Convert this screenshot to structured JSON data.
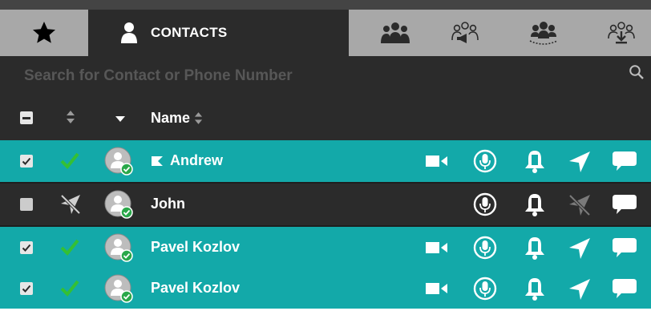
{
  "tabs": {
    "favorites_icon": "star-icon",
    "contacts_label": "CONTACTS",
    "group_icons": [
      "group-icon",
      "broadcast-group-icon",
      "dispatch-group-icon",
      "download-group-icon"
    ]
  },
  "search": {
    "placeholder": "Search for Contact or Phone Number"
  },
  "header": {
    "name_label": "Name"
  },
  "contacts": [
    {
      "name": "Andrew",
      "selected": true,
      "flag": true,
      "online": true,
      "actions": [
        "video-call-icon",
        "microphone-icon",
        "bell-icon",
        "location-icon",
        "chat-icon"
      ]
    },
    {
      "name": "John",
      "selected": false,
      "flag": false,
      "online": false,
      "actions": [
        "microphone-icon",
        "bell-icon",
        "location-off-icon",
        "chat-icon"
      ]
    },
    {
      "name": "Pavel Kozlov",
      "selected": true,
      "flag": false,
      "online": true,
      "actions": [
        "video-call-icon",
        "microphone-icon",
        "bell-icon",
        "location-icon",
        "chat-icon"
      ]
    },
    {
      "name": "Pavel Kozlov",
      "selected": true,
      "flag": false,
      "online": true,
      "actions": [
        "video-call-icon",
        "microphone-icon",
        "bell-icon",
        "location-icon",
        "chat-icon"
      ]
    }
  ],
  "colors": {
    "teal": "#13a9a9",
    "dark": "#2b2b2b",
    "tab_inactive": "#a8a8a8",
    "accent_green": "#34c034"
  }
}
